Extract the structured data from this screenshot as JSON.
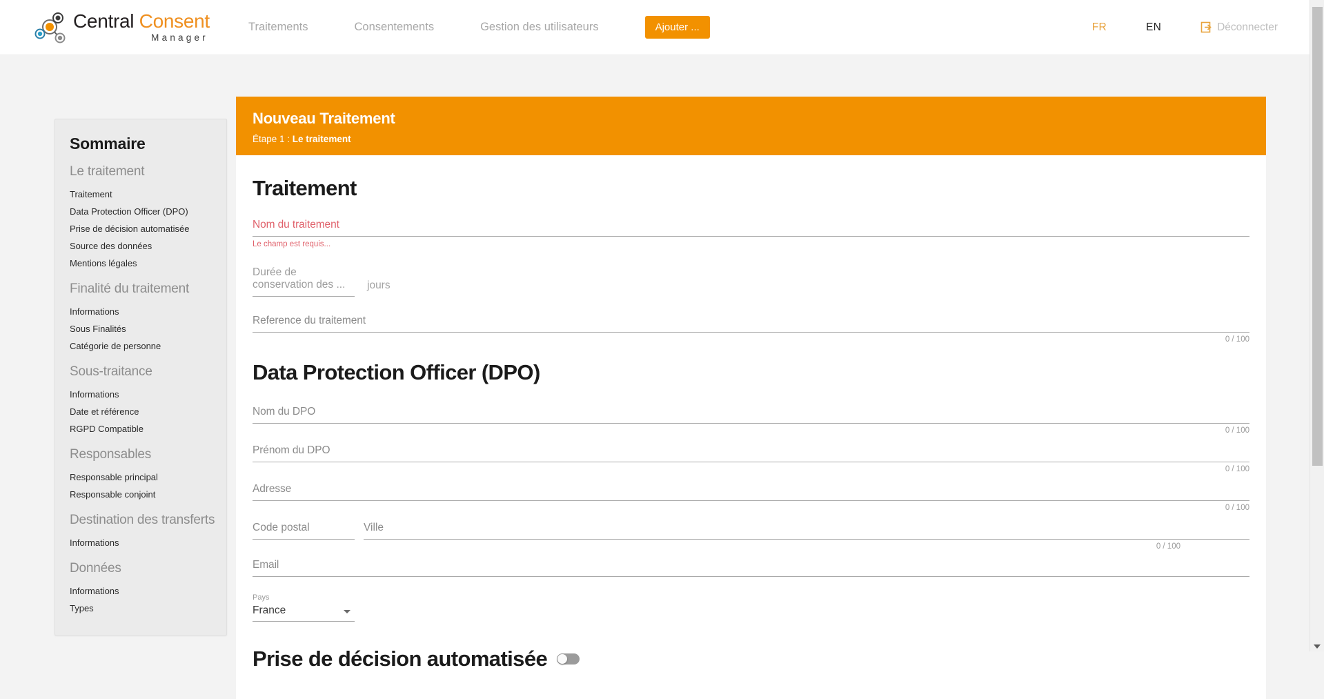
{
  "brand": {
    "name_part1": "Central ",
    "name_part2": "Consent",
    "name_sub": "Manager",
    "accent_color": "#f29100",
    "dark_color": "#231f20"
  },
  "nav": {
    "items": [
      {
        "label": "Traitements"
      },
      {
        "label": "Consentements"
      },
      {
        "label": "Gestion des utilisateurs"
      }
    ],
    "add_button": "Ajouter ...",
    "lang_fr": "FR",
    "lang_en": "EN",
    "logout": "Déconnecter"
  },
  "sidebar": {
    "title": "Sommaire",
    "sections": [
      {
        "group": "Le traitement",
        "items": [
          "Traitement",
          "Data Protection Officer (DPO)",
          "Prise de décision automatisée",
          "Source des données",
          "Mentions légales"
        ]
      },
      {
        "group": "Finalité du traitement",
        "items": [
          "Informations",
          "Sous Finalités",
          "Catégorie de personne"
        ]
      },
      {
        "group": "Sous-traitance",
        "items": [
          "Informations",
          "Date et référence",
          "RGPD Compatible"
        ]
      },
      {
        "group": "Responsables",
        "items": [
          "Responsable principal",
          "Responsable conjoint"
        ]
      },
      {
        "group": "Destination des transferts",
        "items": [
          "Informations"
        ]
      },
      {
        "group": "Données",
        "items": [
          "Informations",
          "Types"
        ]
      }
    ]
  },
  "banner": {
    "title": "Nouveau Traitement",
    "step_prefix": "Étape 1 : ",
    "step_name": "Le traitement"
  },
  "traitement": {
    "heading": "Traitement",
    "nom_label": "Nom du traitement",
    "nom_value": "",
    "nom_error": "Le champ est requis...",
    "duree_label": "Durée de conservation des ...",
    "duree_value": "",
    "duree_unit": "jours",
    "reference_label": "Reference du traitement",
    "reference_value": "",
    "reference_counter": "0 / 100"
  },
  "dpo": {
    "heading": "Data Protection Officer (DPO)",
    "nom_label": "Nom du DPO",
    "nom_value": "",
    "nom_counter": "0 / 100",
    "prenom_label": "Prénom du DPO",
    "prenom_value": "",
    "prenom_counter": "0 / 100",
    "adresse_label": "Adresse",
    "adresse_value": "",
    "adresse_counter": "0 / 100",
    "code_postal_label": "Code postal",
    "code_postal_value": "",
    "ville_label": "Ville",
    "ville_value": "",
    "ville_counter": "0 / 100",
    "email_label": "Email",
    "email_value": "",
    "pays_label": "Pays",
    "pays_value": "France"
  },
  "decision": {
    "heading": "Prise de décision automatisée",
    "toggle_state": "off"
  }
}
